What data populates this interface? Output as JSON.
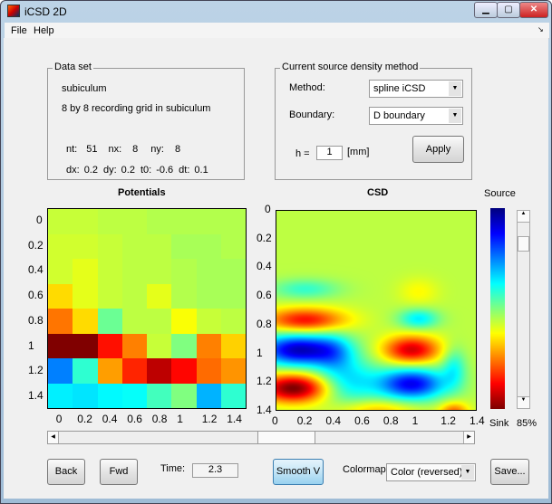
{
  "window": {
    "title": "iCSD 2D",
    "controls": [
      "minimize",
      "maximize",
      "close"
    ]
  },
  "menu": [
    "File",
    "Help"
  ],
  "dataset": {
    "legend": "Data set",
    "name": "subiculum",
    "description": "8 by 8 recording grid in subiculum",
    "params1": [
      {
        "k": "nt:",
        "v": "51"
      },
      {
        "k": "nx:",
        "v": "8"
      },
      {
        "k": "ny:",
        "v": "8"
      }
    ],
    "params2": [
      {
        "k": "dx:",
        "v": "0.2"
      },
      {
        "k": "dy:",
        "v": "0.2"
      },
      {
        "k": "t0:",
        "v": "-0.6"
      },
      {
        "k": "dt:",
        "v": "0.1"
      }
    ]
  },
  "csd_method": {
    "legend": "Current source density method",
    "method_label": "Method:",
    "method_value": "spline iCSD",
    "boundary_label": "Boundary:",
    "boundary_value": "D boundary",
    "h_label": "h =",
    "h_value": "1",
    "h_unit": "[mm]",
    "apply_label": "Apply"
  },
  "chart_data": [
    {
      "type": "heatmap",
      "title": "Potentials",
      "colormap": "jet reversed",
      "x": [
        0,
        0.2,
        0.4,
        0.6,
        0.8,
        1,
        1.2,
        1.4
      ],
      "y": [
        0,
        0.2,
        0.4,
        0.6,
        0.8,
        1,
        1.2,
        1.4
      ],
      "xticks": [
        "0",
        "0.2",
        "0.4",
        "0.6",
        "0.8",
        "1",
        "1.2",
        "1.4"
      ],
      "yticks": [
        "0",
        "0.2",
        "0.4",
        "0.6",
        "0.8",
        "1",
        "1.2",
        "1.4"
      ],
      "values_colormap_index": [
        [
          0.57,
          0.57,
          0.56,
          0.56,
          0.55,
          0.55,
          0.55,
          0.55
        ],
        [
          0.58,
          0.58,
          0.57,
          0.56,
          0.56,
          0.54,
          0.54,
          0.55
        ],
        [
          0.58,
          0.6,
          0.57,
          0.56,
          0.56,
          0.55,
          0.54,
          0.54
        ],
        [
          0.66,
          0.6,
          0.57,
          0.56,
          0.6,
          0.55,
          0.54,
          0.54
        ],
        [
          0.76,
          0.66,
          0.48,
          0.56,
          0.56,
          0.62,
          0.57,
          0.56
        ],
        [
          1.0,
          1.0,
          0.86,
          0.75,
          0.57,
          0.5,
          0.75,
          0.67
        ],
        [
          0.25,
          0.42,
          0.72,
          0.84,
          0.94,
          0.87,
          0.77,
          0.73
        ],
        [
          0.36,
          0.35,
          0.37,
          0.38,
          0.44,
          0.5,
          0.3,
          0.42
        ]
      ]
    },
    {
      "type": "heatmap",
      "title": "CSD",
      "colormap": "jet reversed",
      "interpolation": "smooth",
      "xticks": [
        "0",
        "0.2",
        "0.4",
        "0.6",
        "0.8",
        "1",
        "1.2",
        "1.4"
      ],
      "yticks": [
        "0",
        "0.2",
        "0.4",
        "0.6",
        "0.8",
        "1",
        "1.2",
        "1.4"
      ],
      "xlim": [
        0,
        1.4
      ],
      "ylim": [
        0,
        1.4
      ],
      "features": [
        {
          "x": 0.15,
          "y": 0.98,
          "amp": -1.1,
          "sx": 0.2,
          "sy": 0.08
        },
        {
          "x": 0.12,
          "y": 1.25,
          "amp": 1.0,
          "sx": 0.17,
          "sy": 0.07
        },
        {
          "x": 0.2,
          "y": 0.77,
          "amp": 0.7,
          "sx": 0.2,
          "sy": 0.06
        },
        {
          "x": 0.95,
          "y": 0.98,
          "amp": 0.8,
          "sx": 0.14,
          "sy": 0.07
        },
        {
          "x": 0.95,
          "y": 1.22,
          "amp": -1.0,
          "sx": 0.17,
          "sy": 0.08
        },
        {
          "x": 0.2,
          "y": 0.55,
          "amp": -0.3,
          "sx": 0.17,
          "sy": 0.05
        },
        {
          "x": 1.0,
          "y": 0.76,
          "amp": -0.45,
          "sx": 0.1,
          "sy": 0.05
        },
        {
          "x": 1.25,
          "y": 1.1,
          "amp": -0.35,
          "sx": 0.06,
          "sy": 0.1
        },
        {
          "x": 1.0,
          "y": 0.57,
          "amp": 0.15,
          "sx": 0.1,
          "sy": 0.07
        },
        {
          "x": 1.25,
          "y": 1.42,
          "amp": 0.5,
          "sx": 0.07,
          "sy": 0.05
        },
        {
          "x": 0.5,
          "y": 1.2,
          "amp": -0.45,
          "sx": 0.15,
          "sy": 0.12
        },
        {
          "x": 0.4,
          "y": 1.0,
          "amp": -0.3,
          "sx": 0.1,
          "sy": 0.1
        },
        {
          "x": 0.7,
          "y": 1.4,
          "amp": 0.3,
          "sx": 0.2,
          "sy": 0.05
        }
      ]
    }
  ],
  "colorbar": {
    "top_label": "Source",
    "bottom_label": "Sink",
    "colormap": "jet reversed"
  },
  "vertical_slider": {
    "label": "85%",
    "value": 0.85
  },
  "time_slider": {
    "value_fraction": 0.5
  },
  "bottom": {
    "back_label": "Back",
    "fwd_label": "Fwd",
    "time_label": "Time:",
    "time_value": "2.3",
    "smooth_label": "Smooth V",
    "colormap_label": "Colormap:",
    "colormap_value": "Color (reversed)",
    "save_label": "Save..."
  }
}
